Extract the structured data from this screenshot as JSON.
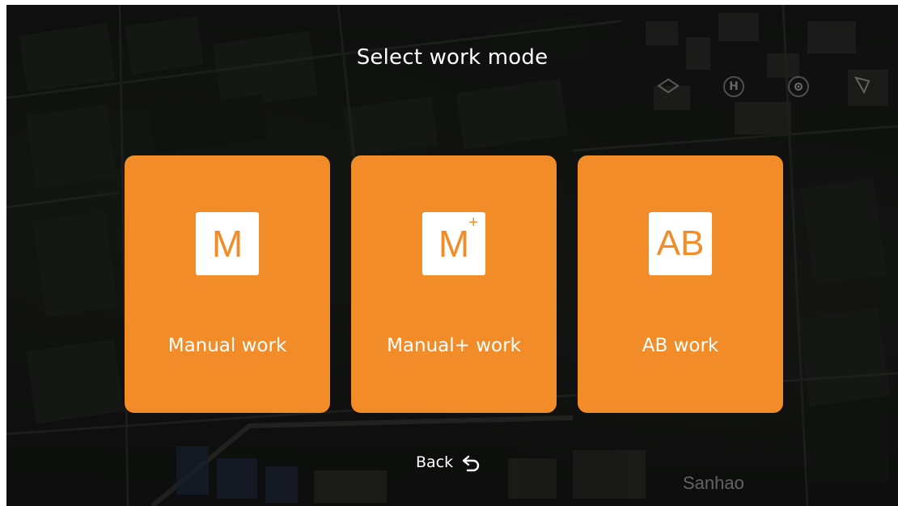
{
  "screen": {
    "title": "Select work mode"
  },
  "modes": [
    {
      "glyph": "M",
      "superscript": "",
      "label": "Manual work",
      "icon": "manual-mode-icon"
    },
    {
      "glyph": "M",
      "superscript": "+",
      "label": "Manual+ work",
      "icon": "manual-plus-mode-icon"
    },
    {
      "glyph": "AB",
      "superscript": "",
      "label": "AB work",
      "icon": "ab-mode-icon"
    }
  ],
  "back": {
    "label": "Back",
    "icon": "return-arrow-icon"
  },
  "map": {
    "place_label": "Sanhao",
    "controls": [
      {
        "icon": "helipad-icon",
        "glyph": "H"
      },
      {
        "icon": "locate-target-icon",
        "glyph": ""
      },
      {
        "icon": "compass-arrow-icon",
        "glyph": ""
      }
    ]
  },
  "colors": {
    "accent": "#f28c28",
    "card_text": "#ffffff",
    "background": "#101210"
  }
}
